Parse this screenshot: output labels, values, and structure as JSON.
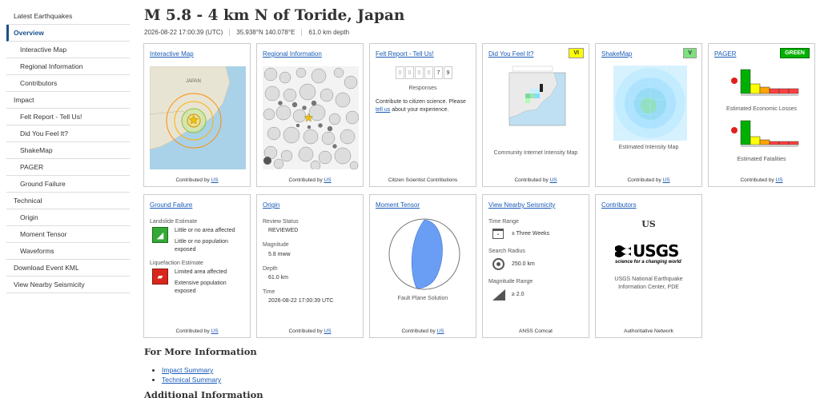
{
  "sidebar": {
    "items": [
      {
        "label": "Latest Earthquakes"
      },
      {
        "label": "Overview"
      },
      {
        "label": "Interactive Map"
      },
      {
        "label": "Regional Information"
      },
      {
        "label": "Contributors"
      },
      {
        "label": "Impact"
      },
      {
        "label": "Felt Report - Tell Us!"
      },
      {
        "label": "Did You Feel It?"
      },
      {
        "label": "ShakeMap"
      },
      {
        "label": "PAGER"
      },
      {
        "label": "Ground Failure"
      },
      {
        "label": "Technical"
      },
      {
        "label": "Origin"
      },
      {
        "label": "Moment Tensor"
      },
      {
        "label": "Waveforms"
      },
      {
        "label": "Download Event KML"
      },
      {
        "label": "View Nearby Seismicity"
      }
    ]
  },
  "header": {
    "title": "M 5.8 - 4 km N of Toride, Japan",
    "time": "2026-08-22 17:00:39 (UTC)",
    "location": "35.938°N 140.078°E",
    "depth": "61.0 km depth"
  },
  "cards": {
    "interactive_map": {
      "title": "Interactive Map",
      "footer_prefix": "Contributed by",
      "footer_link": "US",
      "map_label": "JAPAN"
    },
    "regional": {
      "title": "Regional Information",
      "footer_prefix": "Contributed by",
      "footer_link": "US"
    },
    "felt": {
      "title": "Felt Report - Tell Us!",
      "digits": [
        "0",
        "0",
        "0",
        "0",
        "7",
        "9"
      ],
      "responses": "Responses",
      "text1": "Contribute to citizen science. Please",
      "link": "tell us",
      "text2": "about your experience.",
      "footer": "Citizen Scientist Contributions"
    },
    "dyfi": {
      "title": "Did You Feel It?",
      "badge": "VI",
      "badge_color": "#ffff00",
      "caption": "Community Internet Intensity Map",
      "footer_prefix": "Contributed by",
      "footer_link": "US"
    },
    "shakemap": {
      "title": "ShakeMap",
      "badge": "V",
      "badge_color": "#7fe07f",
      "caption": "Estimated Intensity Map",
      "footer_prefix": "Contributed by",
      "footer_link": "US"
    },
    "pager": {
      "title": "PAGER",
      "badge": "GREEN",
      "badge_color": "#00b000",
      "caption1": "Estimated Economic Losses",
      "caption2": "Estimated Fatalities",
      "footer_prefix": "Contributed by",
      "footer_link": "US"
    },
    "ground_failure": {
      "title": "Ground Failure",
      "landslide_label": "Landslide Estimate",
      "landslide_area": "Little or no area affected",
      "landslide_pop": "Little or no population exposed",
      "liq_label": "Liquefaction Estimate",
      "liq_area": "Limited area affected",
      "liq_pop": "Extensive population exposed",
      "footer_prefix": "Contributed by",
      "footer_link": "US"
    },
    "origin": {
      "title": "Origin",
      "review_label": "Review Status",
      "review_val": "REVIEWED",
      "mag_label": "Magnitude",
      "mag_val": "5.8 mww",
      "depth_label": "Depth",
      "depth_val": "61.0 km",
      "time_label": "Time",
      "time_val": "2026-08-22 17:00:39 UTC",
      "footer_prefix": "Contributed by",
      "footer_link": "US"
    },
    "moment": {
      "title": "Moment Tensor",
      "caption": "Fault Plane Solution",
      "footer_prefix": "Contributed by",
      "footer_link": "US"
    },
    "nearby": {
      "title": "View Nearby Seismicity",
      "time_label": "Time Range",
      "time_val": "± Three Weeks",
      "radius_label": "Search Radius",
      "radius_val": "250.0 km",
      "mag_label": "Magnitude Range",
      "mag_val": "≥ 2.0",
      "footer": "ANSS Comcat"
    },
    "contributors": {
      "title": "Contributors",
      "code": "US",
      "logo_text": "USGS",
      "logo_tagline": "science for a changing world",
      "org": "USGS National Earthquake Information Center, PDE",
      "footer": "Authoritative Network"
    }
  },
  "more_info": {
    "title": "For More Information",
    "links": [
      "Impact Summary",
      "Technical Summary"
    ]
  },
  "additional_title": "Additional Information"
}
